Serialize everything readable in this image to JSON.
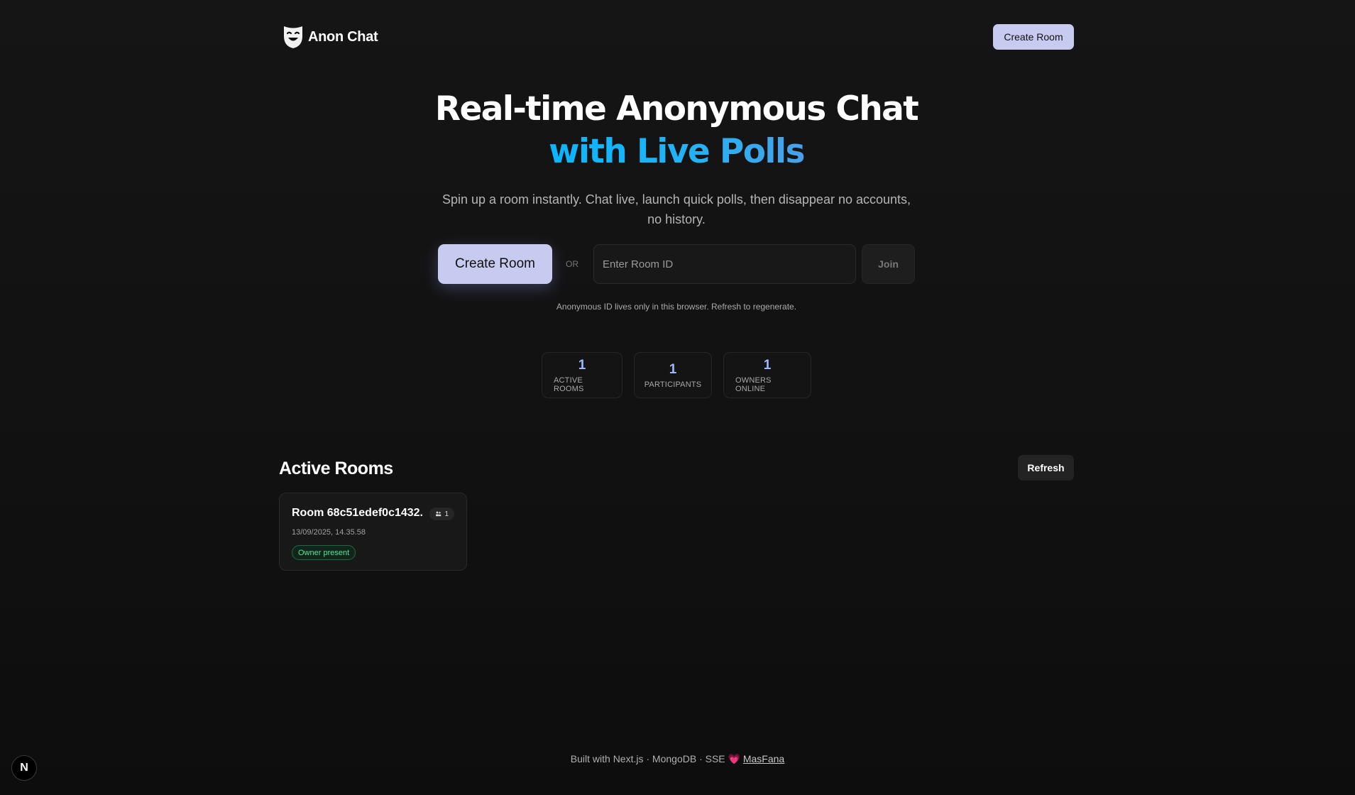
{
  "header": {
    "brand_name": "Anon Chat",
    "logo_icon": "mask-icon",
    "create_room_label": "Create Room"
  },
  "hero": {
    "title_line1": "Real-time Anonymous Chat",
    "title_line2": "with Live Polls",
    "subtitle": "Spin up a room instantly. Chat live, launch quick polls, then disappear no accounts, no history."
  },
  "join": {
    "create_label": "Create Room",
    "or_label": "OR",
    "input_placeholder": "Enter Room ID",
    "input_value": "",
    "join_label": "Join",
    "note": "Anonymous ID lives only in this browser. Refresh to regenerate."
  },
  "stats": [
    {
      "value": "1",
      "label": "ACTIVE ROOMS"
    },
    {
      "value": "1",
      "label": "PARTICIPANTS"
    },
    {
      "value": "1",
      "label": "OWNERS ONLINE"
    }
  ],
  "active_rooms": {
    "title": "Active Rooms",
    "refresh_label": "Refresh",
    "rooms": [
      {
        "name": "Room 68c51edef0c1432...",
        "participants": "1",
        "participants_icon": "users-icon",
        "time": "13/09/2025, 14.35.58",
        "badge": "Owner present"
      }
    ]
  },
  "footer": {
    "text": "Built with Next.js · MongoDB · SSE",
    "heart": "💗",
    "link_label": "MasFana"
  },
  "dev_badge": {
    "label": "N"
  },
  "colors": {
    "background": "#121212",
    "primary_button": "#c7cbef",
    "accent_gradient_start": "#0ab6ff",
    "accent_gradient_end": "#4aa0e8",
    "stat_value": "#9fb8ff",
    "owner_badge_text": "#5ee09a"
  }
}
